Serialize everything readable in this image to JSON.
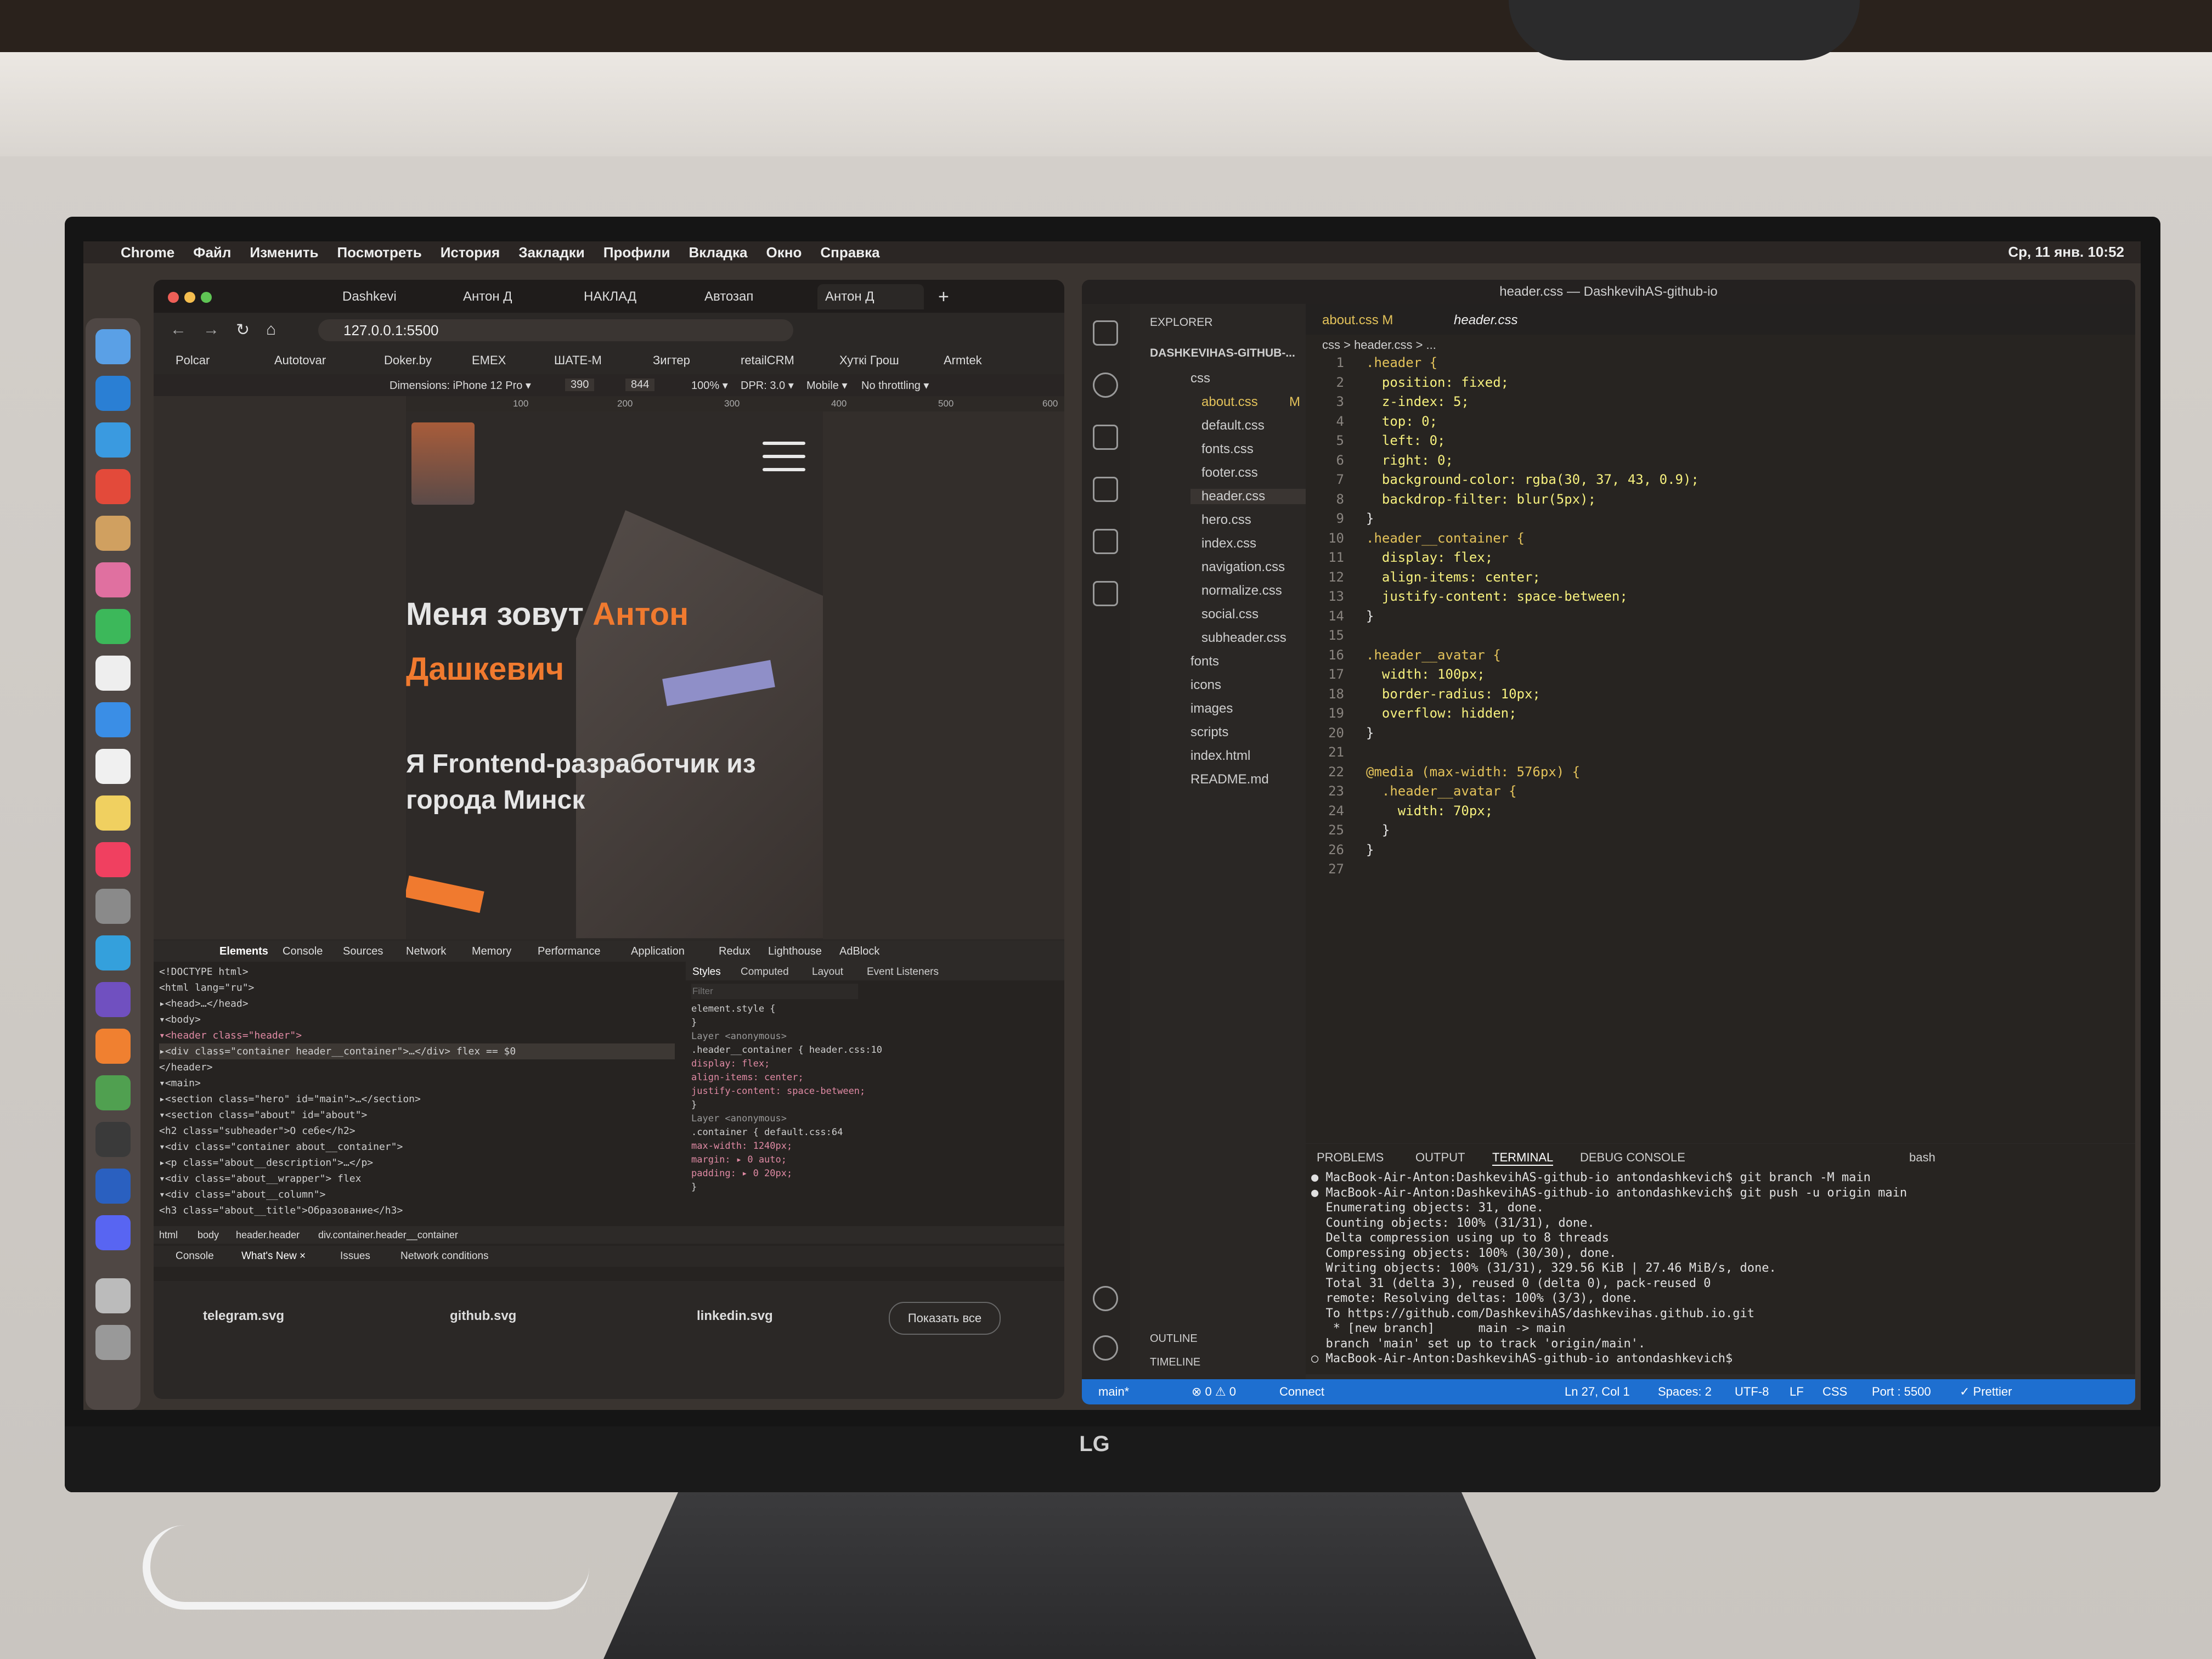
{
  "menubar": {
    "apple": "",
    "items": [
      "Chrome",
      "Файл",
      "Изменить",
      "Посмотреть",
      "История",
      "Закладки",
      "Профили",
      "Вкладка",
      "Окно",
      "Справка"
    ],
    "clock": "Ср, 11 янв. 10:52"
  },
  "chrome": {
    "tabs": [
      "Dashkevi",
      "Антон Д",
      "НАКЛАД",
      "Автозап",
      "Антон Д"
    ],
    "url": "127.0.0.1:5500",
    "bookmarks": [
      "Polcar",
      "Autotovar",
      "Doker.by",
      "EMEX",
      "ШАТЕ-М",
      "Зигтер",
      "retailCRM",
      "Хуткі Грош",
      "Armtek"
    ],
    "device_toolbar": {
      "dimensions": "Dimensions: iPhone 12 Pro ▾",
      "width": "390",
      "height": "844",
      "zoom": "100% ▾",
      "dpr": "DPR: 3.0 ▾",
      "mobile": "Mobile ▾",
      "throttle": "No throttling ▾"
    },
    "ruler": [
      "100",
      "200",
      "300",
      "400",
      "500",
      "600"
    ],
    "page": {
      "name_prefix": "Меня зовут ",
      "name_accent": "Антон Дашкевич",
      "subtitle": "Я Frontend-разработчик из города Минск"
    },
    "devtools": {
      "tabs": [
        "Elements",
        "Console",
        "Sources",
        "Network",
        "Memory",
        "Performance",
        "Application",
        "Redux",
        "Lighthouse",
        "AdBlock"
      ],
      "elements": [
        "<!DOCTYPE html>",
        "<html lang=\"ru\">",
        "▸<head>…</head>",
        "▾<body>",
        "  ▾<header class=\"header\">",
        "  ▸<div class=\"container header__container\">…</div> flex == $0",
        "   </header>",
        "  ▾<main>",
        "    ▸<section class=\"hero\" id=\"main\">…</section>",
        "    ▾<section class=\"about\" id=\"about\">",
        "       <h2 class=\"subheader\">О себе</h2>",
        "      ▾<div class=\"container about__container\">",
        "        ▸<p class=\"about__description\">…</p>",
        "        ▾<div class=\"about__wrapper\"> flex",
        "          ▾<div class=\"about__column\">",
        "             <h3 class=\"about__title\">Образование</h3>"
      ],
      "styles_tabs": [
        "Styles",
        "Computed",
        "Layout",
        "Event Listeners"
      ],
      "filter_placeholder": "Filter",
      "styles": [
        "element.style {",
        "}",
        "Layer <anonymous>",
        ".header__container {          header.css:10",
        "  display: flex;",
        "  align-items: center;",
        "  justify-content: space-between;",
        "}",
        "Layer <anonymous>",
        ".container {                  default.css:64",
        "  max-width: 1240px;",
        "  margin: ▸ 0 auto;",
        "  padding: ▸ 0 20px;",
        "}"
      ],
      "breadcrumbs": [
        "html",
        "body",
        "header.header",
        "div.container.header__container"
      ],
      "drawer_tabs": [
        "Console",
        "What's New ×",
        "Issues",
        "Network conditions"
      ]
    },
    "downloads": [
      "telegram.svg",
      "github.svg",
      "linkedin.svg"
    ],
    "show_all": "Показать все"
  },
  "vscode": {
    "title": "header.css — DashkevihAS-github-io",
    "explorer_title": "EXPLORER",
    "project": "DASHKEVIHAS-GITHUB-...",
    "folder_css": "css",
    "css_files": [
      "about.css",
      "default.css",
      "fonts.css",
      "footer.css",
      "header.css",
      "hero.css",
      "index.css",
      "navigation.css",
      "normalize.css",
      "social.css",
      "subheader.css"
    ],
    "about_badge": "M",
    "folders": [
      "fonts",
      "icons",
      "images",
      "scripts"
    ],
    "root_files": [
      "index.html",
      "README.md"
    ],
    "outline": "OUTLINE",
    "timeline": "TIMELINE",
    "tabs": [
      "about.css M",
      "header.css"
    ],
    "breadcrumb": "css > header.css > ...",
    "code": [
      ".header {",
      "  position: fixed;",
      "  z-index: 5;",
      "  top: 0;",
      "  left: 0;",
      "  right: 0;",
      "  background-color: rgba(30, 37, 43, 0.9);",
      "  backdrop-filter: blur(5px);",
      "}",
      ".header__container {",
      "  display: flex;",
      "  align-items: center;",
      "  justify-content: space-between;",
      "}",
      "",
      ".header__avatar {",
      "  width: 100px;",
      "  border-radius: 10px;",
      "  overflow: hidden;",
      "}",
      "",
      "@media (max-width: 576px) {",
      "  .header__avatar {",
      "    width: 70px;",
      "  }",
      "}",
      ""
    ],
    "panel_tabs": [
      "PROBLEMS",
      "OUTPUT",
      "TERMINAL",
      "DEBUG CONSOLE"
    ],
    "shell": "bash",
    "terminal": [
      "● MacBook-Air-Anton:DashkevihAS-github-io antondashkevich$ git branch -M main",
      "● MacBook-Air-Anton:DashkevihAS-github-io antondashkevich$ git push -u origin main",
      "  Enumerating objects: 31, done.",
      "  Counting objects: 100% (31/31), done.",
      "  Delta compression using up to 8 threads",
      "  Compressing objects: 100% (30/30), done.",
      "  Writing objects: 100% (31/31), 329.56 KiB | 27.46 MiB/s, done.",
      "  Total 31 (delta 3), reused 0 (delta 0), pack-reused 0",
      "  remote: Resolving deltas: 100% (3/3), done.",
      "  To https://github.com/DashkevihAS/dashkevihas.github.io.git",
      "   * [new branch]      main -> main",
      "  branch 'main' set up to track 'origin/main'.",
      "○ MacBook-Air-Anton:DashkevihAS-github-io antondashkevich$ "
    ],
    "status": {
      "branch": "main*",
      "problems": "⊗ 0 ⚠ 0",
      "connect": "Connect",
      "position": "Ln 27, Col 1",
      "spaces": "Spaces: 2",
      "encoding": "UTF-8",
      "eol": "LF",
      "language": "CSS",
      "port": "Port : 5500",
      "prettier": "✓ Prettier"
    }
  },
  "monitor_brand": "LG"
}
